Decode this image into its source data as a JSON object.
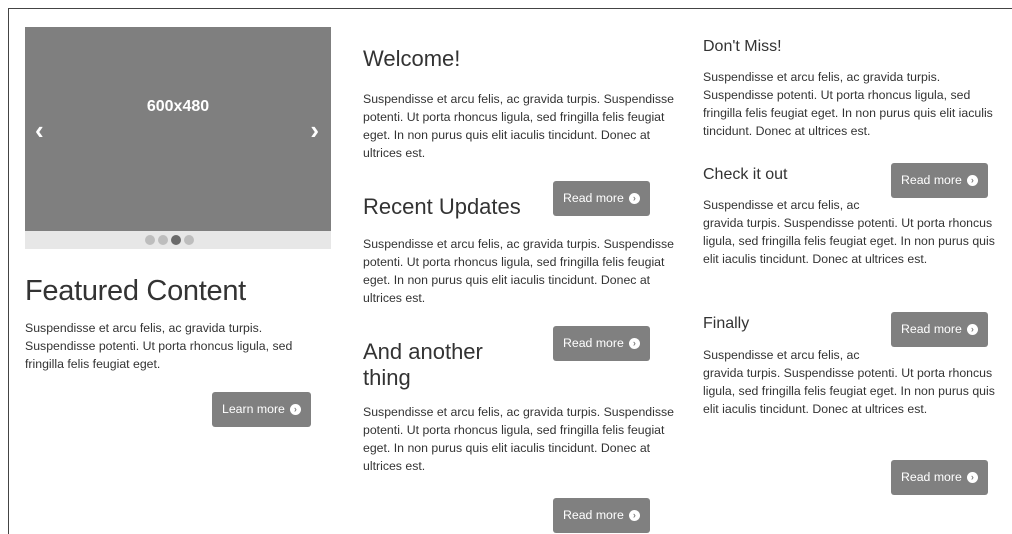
{
  "carousel": {
    "slide_label": "600x480",
    "prev_glyph": "‹",
    "next_glyph": "›",
    "dot_count": 4,
    "active_dot": 2
  },
  "featured": {
    "title": "Featured Content",
    "text": "Suspendisse et arcu felis, ac gravida turpis. Suspendisse potenti. Ut porta rhoncus ligula, sed fringilla felis feugiat eget.",
    "button": "Learn more"
  },
  "middle": {
    "welcome": {
      "title": "Welcome!",
      "text": "Suspendisse et arcu felis, ac gravida turpis. Suspendisse potenti. Ut porta rhoncus ligula, sed fringilla felis feugiat eget. In non purus quis elit iaculis tincidunt. Donec at ultrices est.",
      "button": "Read more"
    },
    "recent": {
      "title": "Recent Updates",
      "text": "Suspendisse et arcu felis, ac gravida turpis. Suspendisse potenti. Ut porta rhoncus ligula, sed fringilla felis feugiat eget. In non purus quis elit iaculis tincidunt. Donec at ultrices est.",
      "button": "Read more"
    },
    "another": {
      "title": "And another thing",
      "text": "Suspendisse et arcu felis, ac gravida turpis. Suspendisse potenti. Ut porta rhoncus ligula, sed fringilla felis feugiat eget. In non purus quis elit iaculis tincidunt. Donec at ultrices est.",
      "button": "Read more"
    }
  },
  "right": {
    "dontmiss": {
      "title": "Don't Miss!",
      "text": "Suspendisse et arcu felis, ac gravida turpis. Suspendisse potenti. Ut porta rhoncus ligula, sed fringilla felis feugiat eget. In non purus quis elit iaculis tincidunt. Donec at ultrices est."
    },
    "checkit": {
      "title": "Check it out",
      "text": "Suspendisse et arcu felis, ac gravida turpis. Suspendisse potenti. Ut porta rhoncus ligula, sed fringilla felis feugiat eget. In non purus quis elit iaculis tincidunt. Donec at ultrices est.",
      "button": "Read more"
    },
    "finally": {
      "title": "Finally",
      "text": "Suspendisse et arcu felis, ac gravida turpis. Suspendisse potenti. Ut porta rhoncus ligula, sed fringilla felis feugiat eget. In non purus quis elit iaculis tincidunt. Donec at ultrices est.",
      "button": "Read more",
      "button2": "Read more"
    }
  },
  "icons": {
    "arrow_circle": "circle-arrow-right-icon"
  },
  "colors": {
    "slide_bg": "#7f7f7f",
    "button_bg": "#808080",
    "carousel_bar": "#e7e7e7"
  }
}
